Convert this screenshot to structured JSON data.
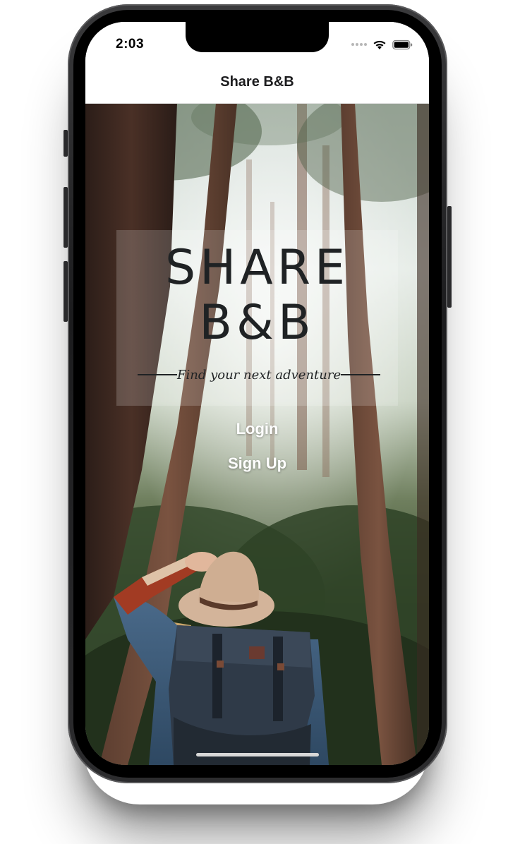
{
  "status_bar": {
    "time": "2:03"
  },
  "nav": {
    "title": "Share B&B"
  },
  "logo": {
    "line1": "SHARE",
    "line2": "B&B",
    "tagline": "Find your next adventure"
  },
  "actions": {
    "login": "Login",
    "signup": "Sign Up"
  },
  "icons": [
    "cellular-signal-icon",
    "wifi-icon",
    "battery-icon"
  ],
  "colors": {
    "logo_text": "#1f2224",
    "action_text": "#ffffff",
    "forest_dark": "#2a2320",
    "forest_green": "#3f5a3a"
  }
}
